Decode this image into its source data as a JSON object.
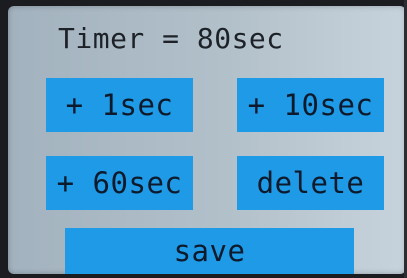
{
  "display": {
    "title": "Timer = 80sec"
  },
  "buttons": {
    "add_1": "+ 1sec",
    "add_10": "+ 10sec",
    "add_60": "+ 60sec",
    "delete": "delete",
    "save": "save"
  },
  "colors": {
    "screen_background": "#b2c0ca",
    "button_fill": "#1e9ae6",
    "text": "#1d2228"
  }
}
